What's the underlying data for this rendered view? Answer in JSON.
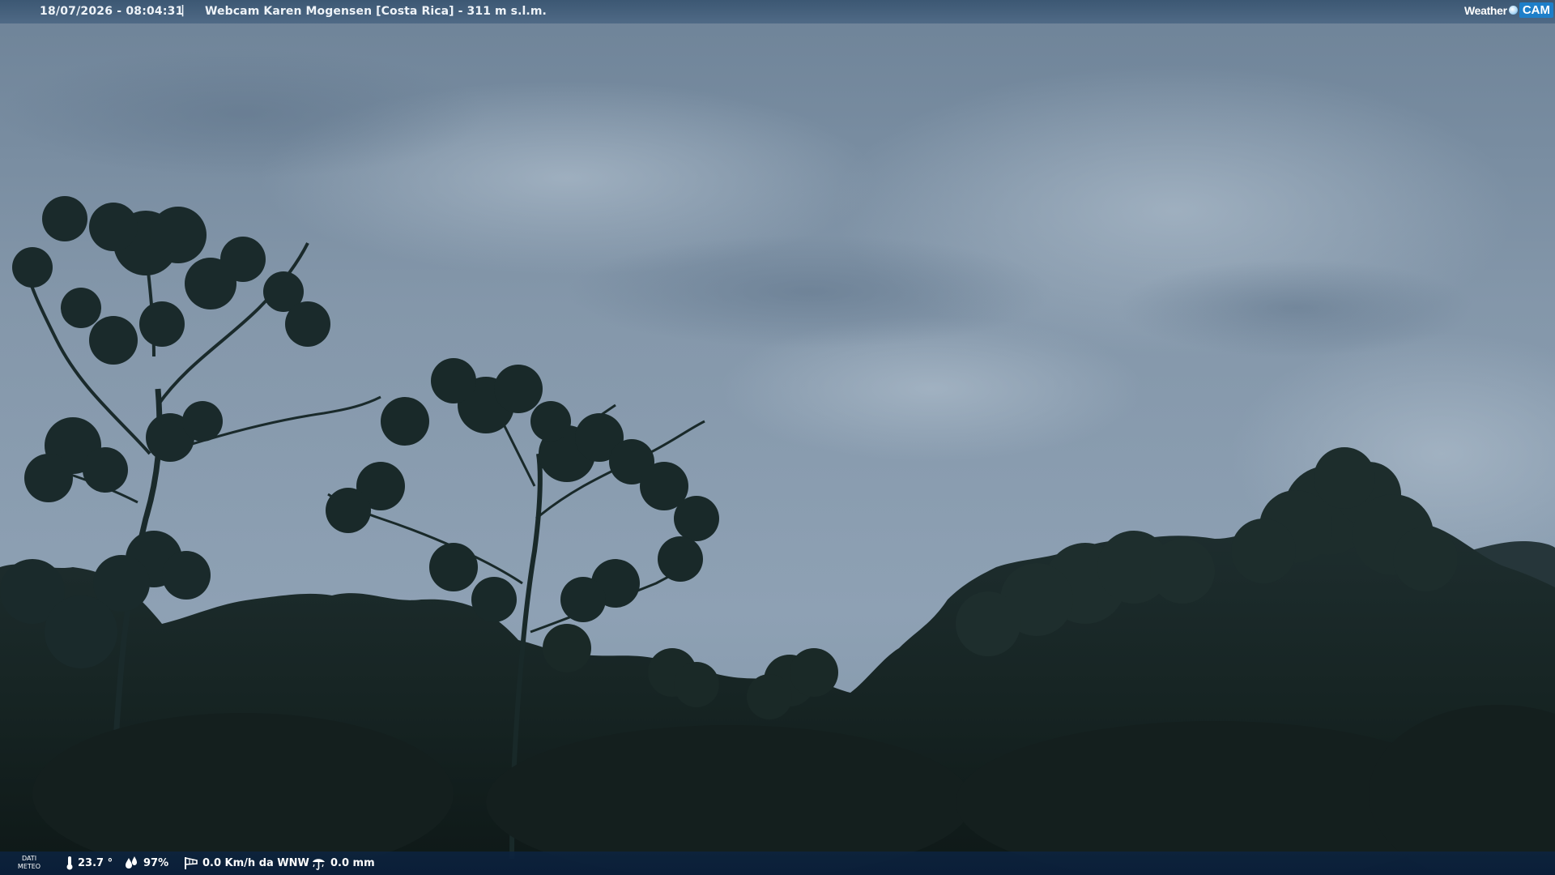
{
  "header": {
    "timestamp": "18/07/2026 - 08:04:31",
    "separator": "|",
    "title": "Webcam Karen Mogensen [Costa Rica]  - 311 m s.l.m.",
    "logo_left": "Weather",
    "logo_right": "CAM"
  },
  "weather": {
    "label_line1": "DATI",
    "label_line2": "METEO",
    "temperature": "23.7 °",
    "humidity": "97%",
    "wind": "0.0 Km/h da WNW",
    "rain": "0.0 mm"
  },
  "colors": {
    "sky_top": "#7e92a6",
    "sky_bottom": "#8ea2b6",
    "foliage": "#1c2c2a",
    "header_bg": "#3f5e80",
    "footer_bg": "#0c2544",
    "logo_accent": "#1e7fc9"
  },
  "icons": {
    "temperature": "thermometer-icon",
    "humidity": "droplets-icon",
    "wind": "windsock-icon",
    "rain": "rain-gauge-icon"
  }
}
